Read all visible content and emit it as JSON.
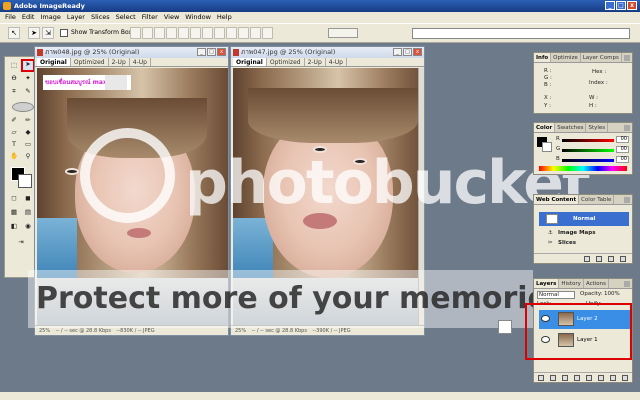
{
  "window": {
    "title": "Adobe ImageReady",
    "buttons": [
      "_",
      "□",
      "x"
    ]
  },
  "menu": [
    "File",
    "Edit",
    "Image",
    "Layer",
    "Slices",
    "Select",
    "Filter",
    "View",
    "Window",
    "Help"
  ],
  "options_bar": {
    "show_transform_box_label": "Show Transform Box"
  },
  "doc1": {
    "title": "ภาพ048.jpg @ 25% (Original)",
    "tabs": [
      "Original",
      "Optimized",
      "2-Up",
      "4-Up"
    ],
    "caption": "ขอบเขื่อนสมบูรณ์ maxx",
    "status": [
      "25%",
      "-- / -- sec @ 28.8 Kbps",
      "--830K / -- JPEG"
    ]
  },
  "doc2": {
    "title": "ภาพ047.jpg @ 25% (Original)",
    "tabs": [
      "Original",
      "Optimized",
      "2-Up",
      "4-Up"
    ],
    "status": [
      "25%",
      "-- / -- sec @ 28.8 Kbps",
      "--390K / -- JPEG"
    ]
  },
  "info_panel": {
    "tabs": [
      "Info",
      "Optimize",
      "Layer Comps"
    ],
    "rows": {
      "r": "R :",
      "g": "G :",
      "b": "B :",
      "hex": "Hex :",
      "index": "Index :",
      "x": "X :",
      "y": "Y :",
      "w": "W :",
      "h": "H :"
    }
  },
  "color_panel": {
    "tabs": [
      "Color",
      "Swatches",
      "Styles"
    ],
    "channels": [
      {
        "label": "R",
        "value": "00"
      },
      {
        "label": "G",
        "value": "00"
      },
      {
        "label": "B",
        "value": "00"
      }
    ]
  },
  "web_content_panel": {
    "tabs": [
      "Web Content",
      "Color Table"
    ],
    "normal_label": "Normal",
    "items": [
      "Image Maps",
      "Slices"
    ]
  },
  "layers_panel": {
    "tabs": [
      "Layers",
      "History",
      "Actions"
    ],
    "blend_mode": "Normal",
    "opacity_label": "Opacity:",
    "opacity_value": "100%",
    "lock_label": "Lock:",
    "unify_label": "Unify:",
    "layers": [
      {
        "name": "Layer 2",
        "selected": true
      },
      {
        "name": "Layer 1",
        "selected": false
      }
    ]
  },
  "watermark": {
    "brand": "photobucket",
    "protect_text": "Protect more of your memories for less!"
  },
  "colors": {
    "accent_red": "#dd0000",
    "selection_blue": "#3a8ee6",
    "panel_bg": "#ece9d8",
    "title_blue": "#2b5fb3"
  }
}
